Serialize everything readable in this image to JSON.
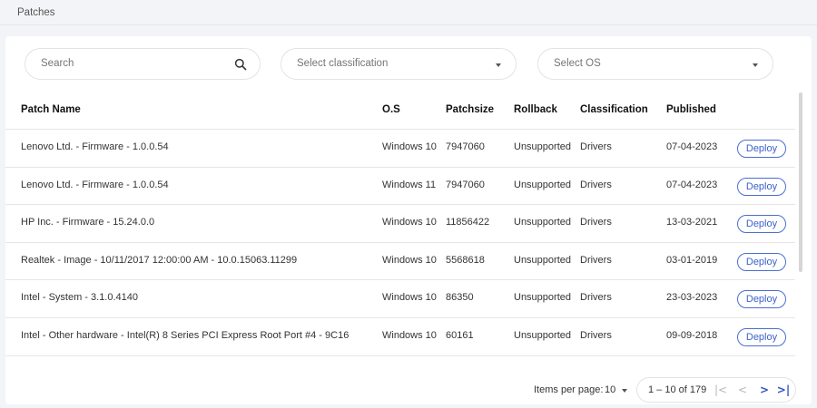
{
  "breadcrumb": "Patches",
  "filters": {
    "search_placeholder": "Search",
    "classification_placeholder": "Select classification",
    "os_placeholder": "Select OS"
  },
  "table": {
    "headers": [
      "Patch Name",
      "O.S",
      "Patchsize",
      "Rollback",
      "Classification",
      "Published"
    ],
    "deploy_label": "Deploy",
    "rows": [
      [
        "Lenovo Ltd. - Firmware - 1.0.0.54",
        "Windows 10",
        "7947060",
        "Unsupported",
        "Drivers",
        "07-04-2023"
      ],
      [
        "Lenovo Ltd. - Firmware - 1.0.0.54",
        "Windows 11",
        "7947060",
        "Unsupported",
        "Drivers",
        "07-04-2023"
      ],
      [
        "HP Inc. - Firmware - 15.24.0.0",
        "Windows 10",
        "11856422",
        "Unsupported",
        "Drivers",
        "13-03-2021"
      ],
      [
        "Realtek - Image - 10/11/2017 12:00:00 AM - 10.0.15063.11299",
        "Windows 10",
        "5568618",
        "Unsupported",
        "Drivers",
        "03-01-2019"
      ],
      [
        "Intel - System - 3.1.0.4140",
        "Windows 10",
        "86350",
        "Unsupported",
        "Drivers",
        "23-03-2023"
      ],
      [
        "Intel - Other hardware - Intel(R) 8 Series PCI Express Root Port #4 - 9C16",
        "Windows 10",
        "60161",
        "Unsupported",
        "Drivers",
        "09-09-2018"
      ]
    ]
  },
  "pagination": {
    "items_per_page_label": "Items per page:",
    "items_per_page_value": "10",
    "range": "1 – 10 of 179",
    "first_icon": "|<",
    "prev_icon": "<",
    "next_icon": ">",
    "last_icon": ">|"
  }
}
